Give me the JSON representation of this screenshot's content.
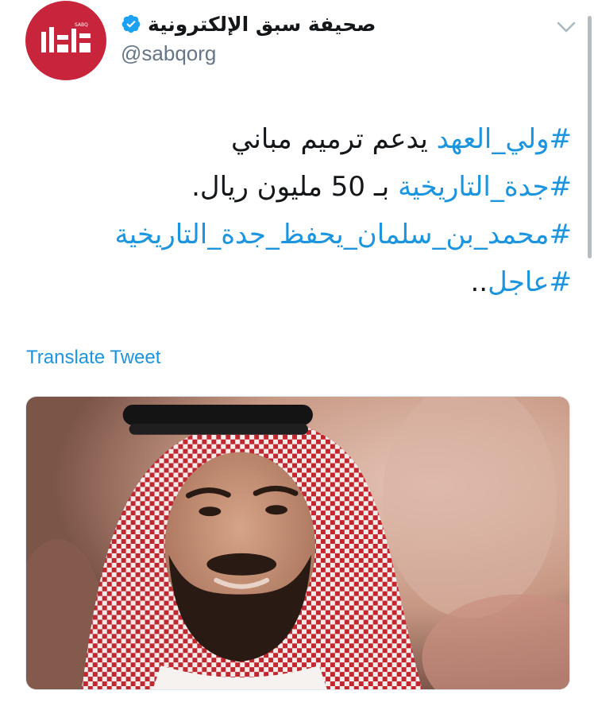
{
  "author": {
    "display_name": "صحيفة سبق الإلكترونية",
    "handle": "@sabqorg",
    "verified": true,
    "avatar_icon": "sabq-logo",
    "brand_color": "#c8243c"
  },
  "tweet": {
    "lines": [
      [
        {
          "text": "#ولي_العهد",
          "hashtag": true
        },
        {
          "text": " يدعم ترميم مباني",
          "hashtag": false
        }
      ],
      [
        {
          "text": "#جدة_التاريخية",
          "hashtag": true
        },
        {
          "text": " بـ 50 مليون ريال.",
          "hashtag": false
        }
      ],
      [
        {
          "text": "#محمد_بن_سلمان_يحفظ_جدة_التاريخية",
          "hashtag": true
        }
      ],
      [
        {
          "text": "#عاجل",
          "hashtag": true
        },
        {
          "text": "..",
          "hashtag": false
        }
      ]
    ],
    "hashtag_color": "#1b95e0"
  },
  "translate_label": "Translate Tweet",
  "media": {
    "type": "photo",
    "icon": "photo-portrait"
  },
  "menu_icon": "chevron-down-icon"
}
